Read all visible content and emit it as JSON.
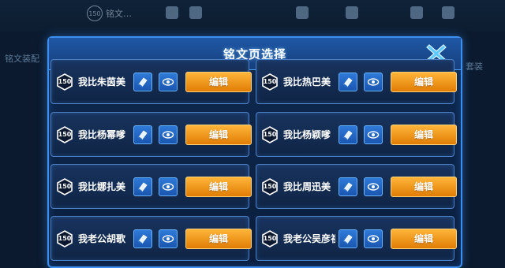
{
  "background": {
    "level": "150",
    "level_text": "铭文…",
    "left_label": "铭文装配",
    "right_label": "套装"
  },
  "dialog": {
    "title": "铭文页选择",
    "close_icon": "close-x-icon"
  },
  "pages": [
    {
      "level": "150",
      "name": "我比朱茵美",
      "edit_label": "编辑"
    },
    {
      "level": "150",
      "name": "我比热巴美",
      "edit_label": "编辑"
    },
    {
      "level": "150",
      "name": "我比杨幂嗲",
      "edit_label": "编辑"
    },
    {
      "level": "150",
      "name": "我比杨颖嗲",
      "edit_label": "编辑"
    },
    {
      "level": "150",
      "name": "我比娜扎美",
      "edit_label": "编辑"
    },
    {
      "level": "150",
      "name": "我比周迅美",
      "edit_label": "编辑"
    },
    {
      "level": "150",
      "name": "我老公胡歌",
      "edit_label": "编辑"
    },
    {
      "level": "150",
      "name": "我老公吴彦祖",
      "edit_label": "编辑"
    }
  ],
  "colors": {
    "accent_blue": "#3d8ff0",
    "edit_orange": "#f59a1a",
    "header_blue": "#1f58a6"
  }
}
